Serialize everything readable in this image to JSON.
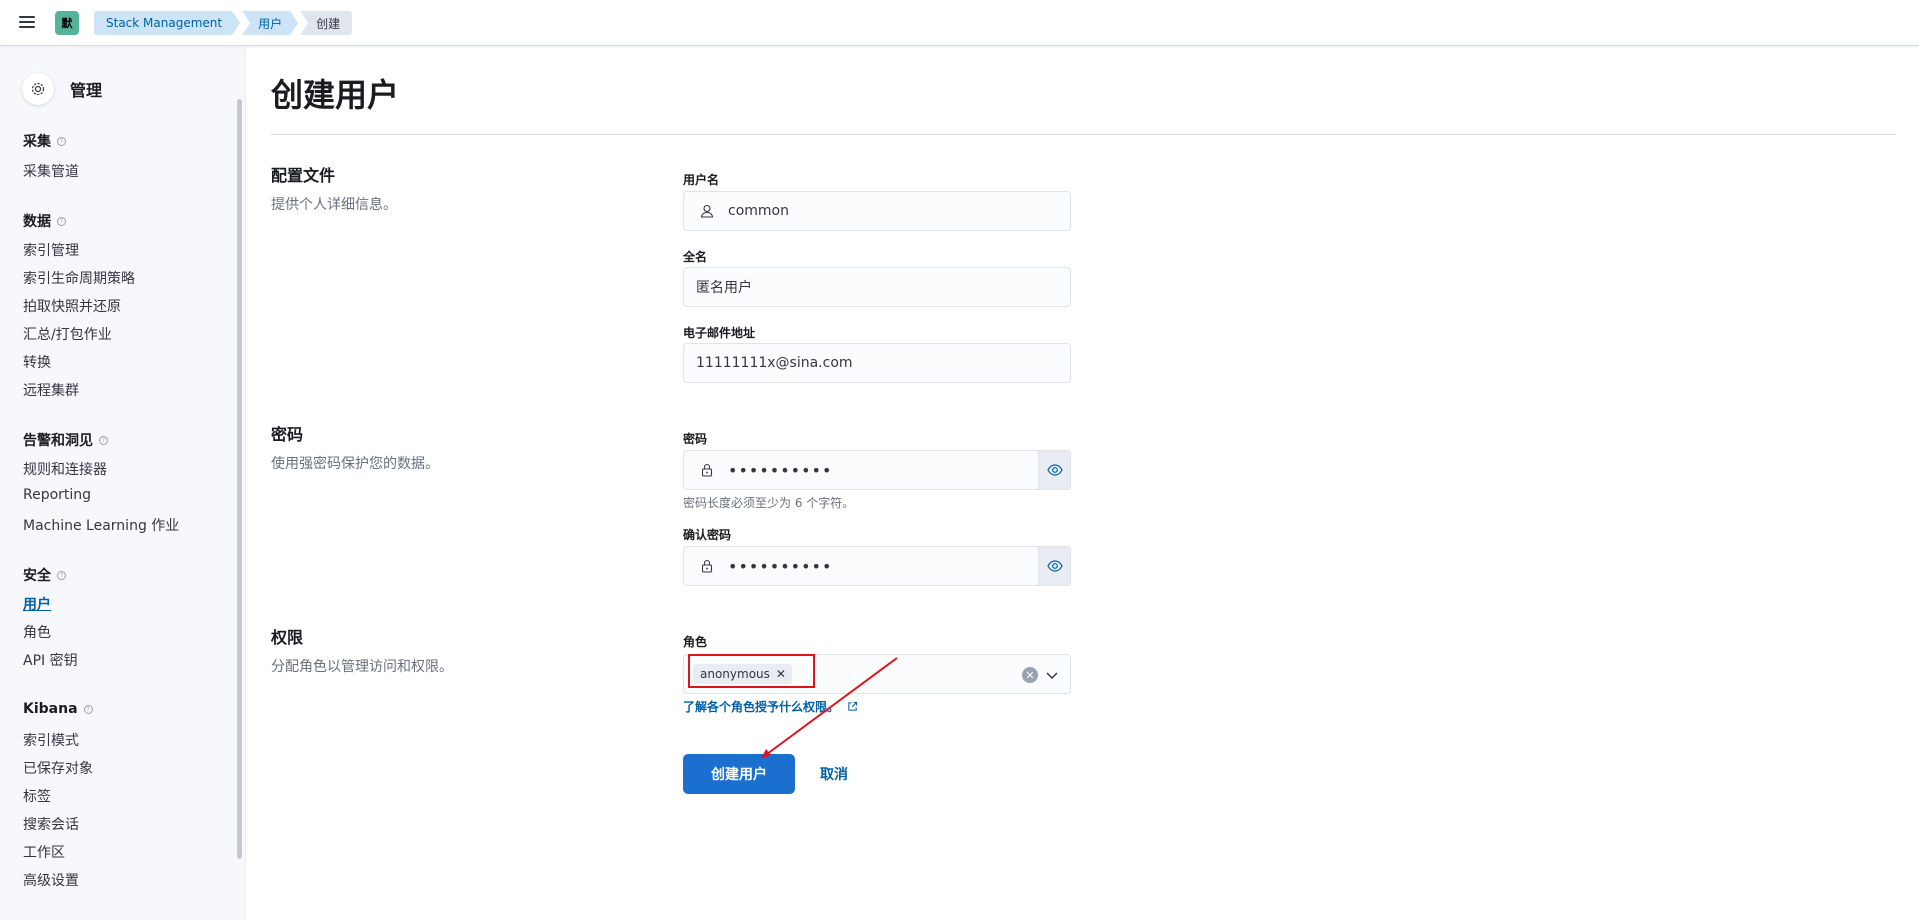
{
  "header": {
    "space_initial": "默",
    "breadcrumbs": [
      "Stack Management",
      "用户",
      "创建"
    ]
  },
  "sidebar": {
    "title": "管理",
    "groups": [
      {
        "label": "采集",
        "items": [
          "采集管道"
        ]
      },
      {
        "label": "数据",
        "items": [
          "索引管理",
          "索引生命周期策略",
          "拍取快照并还原",
          "汇总/打包作业",
          "转换",
          "远程集群"
        ]
      },
      {
        "label": "告警和洞见",
        "items": [
          "规则和连接器",
          "Reporting",
          "Machine Learning 作业"
        ]
      },
      {
        "label": "安全",
        "items": [
          "用户",
          "角色",
          "API 密钥"
        ]
      },
      {
        "label": "Kibana",
        "items": [
          "索引模式",
          "已保存对象",
          "标签",
          "搜索会话",
          "工作区",
          "高级设置"
        ]
      }
    ],
    "active_item": "用户"
  },
  "page": {
    "title": "创建用户",
    "profile": {
      "title": "配置文件",
      "desc": "提供个人详细信息。",
      "username_label": "用户名",
      "username_value": "common",
      "fullname_label": "全名",
      "fullname_value": "匿名用户",
      "email_label": "电子邮件地址",
      "email_value": "11111111x@sina.com"
    },
    "password": {
      "title": "密码",
      "desc": "使用强密码保护您的数据。",
      "password_label": "密码",
      "password_value": "••••••••••",
      "password_help": "密码长度必须至少为 6 个字符。",
      "confirm_label": "确认密码",
      "confirm_value": "••••••••••"
    },
    "privileges": {
      "title": "权限",
      "desc": "分配角色以管理访问和权限。",
      "roles_label": "角色",
      "selected_role": "anonymous",
      "learn_link": "了解各个角色授予什么权限。"
    },
    "actions": {
      "create": "创建用户",
      "cancel": "取消"
    }
  },
  "colors": {
    "accent": "#1b6fcf",
    "link": "#0061a6",
    "annotation": "#e0141e"
  }
}
